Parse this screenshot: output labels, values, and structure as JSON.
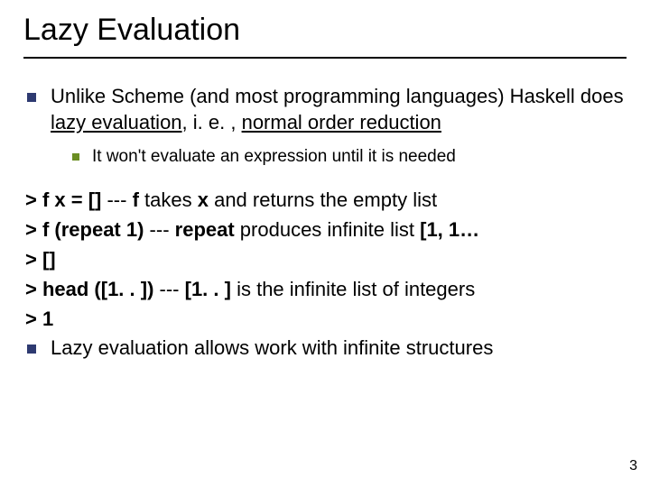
{
  "title": "Lazy Evaluation",
  "b1_pre": "Unlike Scheme (and most programming languages) Haskell does ",
  "b1_u1": "lazy evaluation",
  "b1_mid": ", i. e. , ",
  "b1_u2": "normal order reduction",
  "b2": "It won't evaluate an expression until it is needed",
  "c1a": "> f x = [] ",
  "c1b": "--- ",
  "c1c": "f",
  "c1d": " takes ",
  "c1e": "x",
  "c1f": " and returns the empty list",
  "c2a": "> f (repeat 1) ",
  "c2b": "--- ",
  "c2c": "repeat",
  "c2d": " produces infinite list ",
  "c2e": "[1, 1…",
  "c3": "> []",
  "c4a": "> head ([1. . ]) ",
  "c4b": "--- ",
  "c4c": "[1. . ]",
  "c4d": " is the infinite list of integers",
  "c5": "> 1",
  "b3": "Lazy evaluation allows work with infinite structures",
  "page": "3"
}
